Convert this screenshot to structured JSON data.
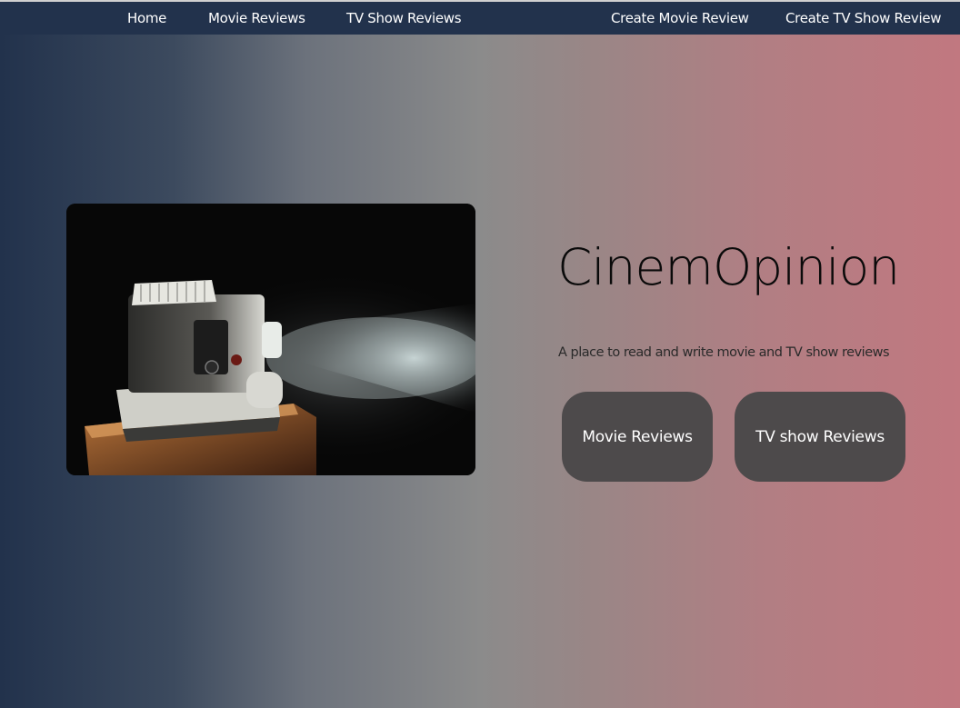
{
  "nav": {
    "home": "Home",
    "movie_reviews": "Movie Reviews",
    "tv_show_reviews": "TV Show Reviews",
    "create_movie_review": "Create Movie Review",
    "create_tv_show_review": "Create TV Show Review"
  },
  "hero": {
    "title": "CinemOpinion",
    "tagline": "A place to read and write movie and TV show reviews",
    "movie_button": "Movie Reviews",
    "tv_button": "TV show Reviews"
  },
  "colors": {
    "navbar": "#22324c",
    "gradient_left": "#22324c",
    "gradient_right": "#c17880",
    "button_bg": "#4d4a4b"
  }
}
